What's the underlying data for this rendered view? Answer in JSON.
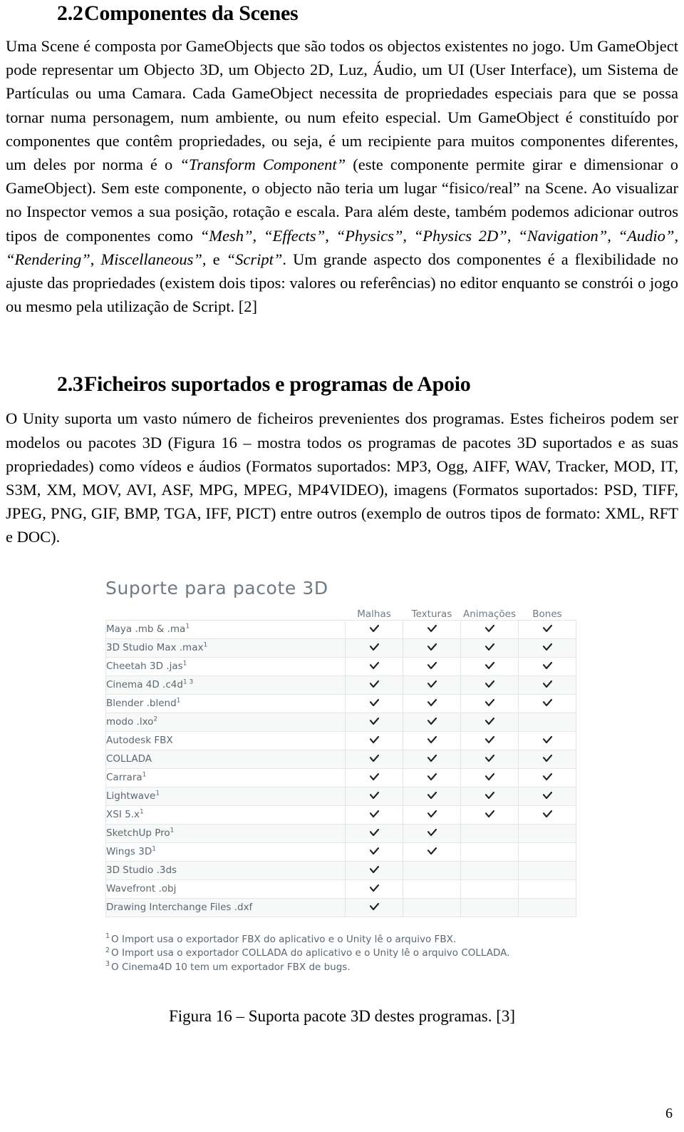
{
  "sections": [
    {
      "number": "2.2",
      "title": "Componentes da Scenes",
      "paragraph": "Uma Scene é composta por GameObjects que são todos os objectos existentes no jogo. Um GameObject pode representar um Objecto 3D, um Objecto 2D, Luz, Áudio, um UI (User Interface), um Sistema de Partículas ou uma Camara. Cada GameObject necessita de propriedades especiais para que se possa tornar numa personagem, num ambiente, ou num efeito especial. Um GameObject é constituído por componentes que contêm propriedades, ou seja, é um recipiente para muitos componentes diferentes, um deles por norma é o “Transform Component” (este componente permite girar e dimensionar o GameObject). Sem este componente, o objecto não teria um lugar “fisico/real” na Scene. Ao visualizar no Inspector vemos a sua posição, rotação e escala. Para além deste, também podemos adicionar outros tipos de componentes como “Mesh”, “Effects”, “Physics”, “Physics 2D”, “Navigation”, “Audio”, “Rendering”, Miscellaneous”, e “Script”. Um grande aspecto dos componentes é a flexibilidade no ajuste das propriedades (existem dois tipos: valores ou referências) no editor enquanto se constrói o jogo ou mesmo pela utilização de Script. [2]"
    },
    {
      "number": "2.3",
      "title": "Ficheiros suportados e programas de Apoio",
      "paragraph": "O Unity suporta um vasto número de ficheiros prevenientes dos programas. Estes ficheiros podem ser modelos ou pacotes 3D (Figura 16 – mostra todos os programas de pacotes 3D suportados e as suas propriedades) como vídeos e áudios (Formatos suportados: MP3, Ogg, AIFF, WAV, Tracker, MOD, IT, S3M, XM, MOV, AVI, ASF, MPG, MPEG, MP4VIDEO), imagens (Formatos suportados: PSD, TIFF, JPEG, PNG, GIF, BMP, TGA, IFF, PICT) entre outros (exemplo de outros tipos de formato: XML, RFT e DOC)."
    }
  ],
  "figure": {
    "title": "Suporte para pacote 3D",
    "columns": [
      "",
      "Malhas",
      "Texturas",
      "Animações",
      "Bones"
    ],
    "rows": [
      {
        "name": "Maya .mb & .ma",
        "note": "1",
        "checks": [
          true,
          true,
          true,
          true
        ]
      },
      {
        "name": "3D Studio Max .max",
        "note": "1",
        "checks": [
          true,
          true,
          true,
          true
        ]
      },
      {
        "name": "Cheetah 3D .jas",
        "note": "1",
        "checks": [
          true,
          true,
          true,
          true
        ]
      },
      {
        "name": "Cinema 4D .c4d",
        "note": "1 3",
        "checks": [
          true,
          true,
          true,
          true
        ]
      },
      {
        "name": "Blender .blend",
        "note": "1",
        "checks": [
          true,
          true,
          true,
          true
        ]
      },
      {
        "name": "modo .lxo",
        "note": "2",
        "checks": [
          true,
          true,
          true,
          false
        ]
      },
      {
        "name": "Autodesk FBX",
        "note": "",
        "checks": [
          true,
          true,
          true,
          true
        ]
      },
      {
        "name": "COLLADA",
        "note": "",
        "checks": [
          true,
          true,
          true,
          true
        ]
      },
      {
        "name": "Carrara",
        "note": "1",
        "checks": [
          true,
          true,
          true,
          true
        ]
      },
      {
        "name": "Lightwave",
        "note": "1",
        "checks": [
          true,
          true,
          true,
          true
        ]
      },
      {
        "name": "XSI 5.x",
        "note": "1",
        "checks": [
          true,
          true,
          true,
          true
        ]
      },
      {
        "name": "SketchUp Pro",
        "note": "1",
        "checks": [
          true,
          true,
          false,
          false
        ]
      },
      {
        "name": "Wings 3D",
        "note": "1",
        "checks": [
          true,
          true,
          false,
          false
        ]
      },
      {
        "name": "3D Studio .3ds",
        "note": "",
        "checks": [
          true,
          false,
          false,
          false
        ]
      },
      {
        "name": "Wavefront .obj",
        "note": "",
        "checks": [
          true,
          false,
          false,
          false
        ]
      },
      {
        "name": "Drawing Interchange Files .dxf",
        "note": "",
        "checks": [
          true,
          false,
          false,
          false
        ]
      }
    ],
    "footnotes": [
      {
        "marker": "1",
        "text": "O Import usa o exportador FBX do aplicativo e o Unity lê o arquivo FBX."
      },
      {
        "marker": "2",
        "text": "O Import usa o exportador COLLADA do aplicativo e o Unity lê o arquivo COLLADA."
      },
      {
        "marker": "3",
        "text": "O Cinema4D 10 tem um exportador FBX de bugs."
      }
    ],
    "caption": "Figura 16 – Suporta pacote 3D destes programas. [3]"
  },
  "page_number": "6",
  "colors": {
    "table_text": "#5a6770",
    "table_header_text": "#6e7b85",
    "table_border": "#e3e6e8",
    "row_alt_background": "#f7f8f8",
    "check_color": "#1d2124"
  }
}
